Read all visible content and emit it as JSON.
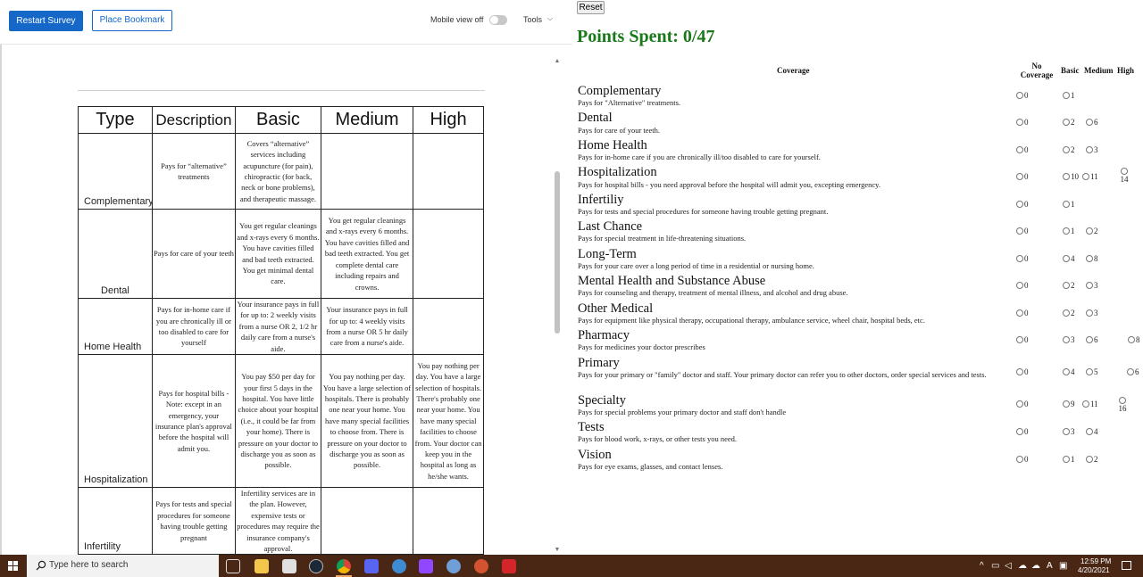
{
  "survey": {
    "restart_label": "Restart Survey",
    "bookmark_label": "Place Bookmark",
    "mobile_view_label": "Mobile view off",
    "tools_label": "Tools",
    "table": {
      "headers": [
        "Type",
        "Description",
        "Basic",
        "Medium",
        "High"
      ],
      "rows": [
        {
          "type": "Complementary",
          "description": "Pays for “alternative” treatments",
          "basic": "Covers “alternative” services including acupuncture (for pain), chiropractic (for back, neck or bone problems), and therapeutic massage.",
          "medium": "",
          "high": ""
        },
        {
          "type": "Dental",
          "description": "Pays for care of your teeth",
          "basic": "You get regular cleanings and x-rays every 6 months. You have cavities filled and bad teeth extracted. You get minimal dental care.",
          "medium": "You get regular cleanings and x-rays every 6 months. You have cavities filled and bad teeth extracted. You get complete dental care including repairs and crowns.",
          "high": ""
        },
        {
          "type": "Home Health",
          "description": "Pays for in-home care if you are chronically ill or too disabled to care for yourself",
          "basic": "Your insurance pays in full for up to: 2 weekly visits from a nurse OR 2, 1/2 hr daily care from a nurse's aide.",
          "medium": "Your insurance pays in full for up to: 4 weekly visits from a nurse OR 5 hr daily care from a nurse's aide.",
          "high": ""
        },
        {
          "type": "Hospitalization",
          "description": "Pays for hospital bills - Note: except in an emergency, your insurance plan's approval before the hospital will admit you.",
          "basic": "You pay $50 per day for your first 5 days in the hospital. You have little choice about your hospital (i.e., it could be far from your home). There is pressure on your doctor to discharge you as soon as possible.",
          "medium": "You pay nothing per day. You have a large selection of hospitals. There is probably one near your home. You have many special facilities to choose from. There is pressure on your doctor to discharge you as soon as possible.",
          "high": "You pay nothing per day. You have a large selection of hospitals. There's probably one near your home. You have many special facilities to choose from. Your doctor can keep you in the hospital as long as he/she wants."
        },
        {
          "type": "Infertility",
          "description": "Pays for tests and special procedures for someone having trouble getting pregnant",
          "basic": "Infertility services are in the plan. However, expensive tests or procedures may require the insurance company's approval.",
          "medium": "",
          "high": ""
        }
      ]
    },
    "scroll_up": "▲",
    "scroll_down": "▼"
  },
  "budget": {
    "reset_label": "Reset",
    "points_label": "Points Spent: 0/47",
    "col_coverage": "Coverage",
    "col_no_coverage_1": "No",
    "col_no_coverage_2": "Coverage",
    "col_basic": "Basic",
    "col_medium": "Medium",
    "col_high": "High",
    "items": [
      {
        "name": "Complementary",
        "desc": "Pays for \"Alternative\" treatments.",
        "none": "0",
        "basic": "1",
        "medium": "",
        "high": ""
      },
      {
        "name": "Dental",
        "desc": "Pays for care of your teeth.",
        "none": "0",
        "basic": "2",
        "medium": "6",
        "high": ""
      },
      {
        "name": "Home Health",
        "desc": "Pays for in-home care if you are chronically ill/too disabled to care for yourself.",
        "none": "0",
        "basic": "2",
        "medium": "3",
        "high": ""
      },
      {
        "name": "Hospitalization",
        "desc": "Pays for hospital bills - you need approval before the hospital will admit you, excepting emergency.",
        "none": "0",
        "basic": "10",
        "medium": "11",
        "high": "14"
      },
      {
        "name": "Infertiliy",
        "desc": "Pays for tests and special procedures for someone having trouble getting pregnant.",
        "none": "0",
        "basic": "1",
        "medium": "",
        "high": ""
      },
      {
        "name": "Last Chance",
        "desc": "Pays for special treatment in life-threatening situations.",
        "none": "0",
        "basic": "1",
        "medium": "2",
        "high": ""
      },
      {
        "name": "Long-Term",
        "desc": "Pays for your care over a long period of time in a residential or nursing home.",
        "none": "0",
        "basic": "4",
        "medium": "8",
        "high": ""
      },
      {
        "name": "Mental Health and Substance Abuse",
        "desc": "Pays for counseling and therapy, treatment of mental illness, and alcohol and drug abuse.",
        "none": "0",
        "basic": "2",
        "medium": "3",
        "high": ""
      },
      {
        "name": "Other Medical",
        "desc": "Pays for equipment like physical therapy, occupational therapy, ambulance service, wheel chair, hospital beds, etc.",
        "none": "0",
        "basic": "2",
        "medium": "3",
        "high": ""
      },
      {
        "name": "Pharmacy",
        "desc": "Pays for medicines your doctor prescribes",
        "none": "0",
        "basic": "3",
        "medium": "6",
        "high": "8"
      },
      {
        "name": "Primary",
        "desc": "Pays for your primary or \"family\" doctor and staff. Your primary doctor can refer you to other doctors, order special services and tests.",
        "none": "0",
        "basic": "4",
        "medium": "5",
        "high": "6"
      },
      {
        "name": "Specialty",
        "desc": "Pays for special problems your primary doctor and staff don't handle",
        "none": "0",
        "basic": "9",
        "medium": "11",
        "high": "16"
      },
      {
        "name": "Tests",
        "desc": "Pays for blood work, x-rays, or other tests you need.",
        "none": "0",
        "basic": "3",
        "medium": "4",
        "high": ""
      },
      {
        "name": "Vision",
        "desc": "Pays for eye exams, glasses, and contact lenses.",
        "none": "0",
        "basic": "1",
        "medium": "2",
        "high": ""
      }
    ]
  },
  "taskbar": {
    "search_placeholder": "Type here to search",
    "time": "12:59 PM",
    "date": "4/20/2021",
    "tray_language": "A",
    "apps": [
      "task-view",
      "file-explorer",
      "store",
      "steam",
      "chrome",
      "discord",
      "qbittorrent",
      "twitch",
      "r-app",
      "powerpoint",
      "acrobat"
    ]
  },
  "colors": {
    "accent_blue": "#1568c8",
    "points_green": "#1a7a1a",
    "taskbar": "#4a2714"
  }
}
